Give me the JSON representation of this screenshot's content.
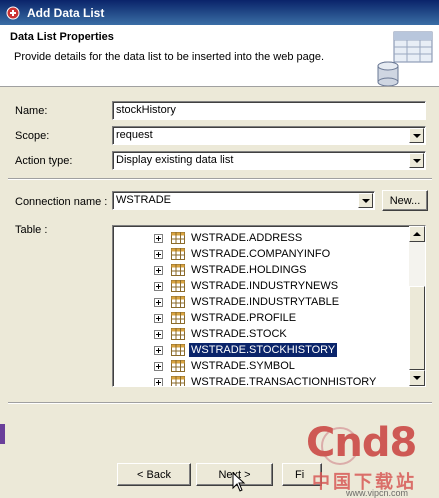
{
  "window": {
    "title": "Add Data List"
  },
  "header": {
    "title": "Data List Properties",
    "description": "Provide details for the data list to be inserted into the web page."
  },
  "form": {
    "name_label": "Name:",
    "name_value": "stockHistory",
    "scope_label": "Scope:",
    "scope_value": "request",
    "action_label": "Action type:",
    "action_value": "Display existing data list",
    "connection_label": "Connection name :",
    "connection_value": "WSTRADE",
    "new_button": "New...",
    "table_label": "Table :"
  },
  "tables": [
    {
      "label": "WSTRADE.ADDRESS",
      "selected": false
    },
    {
      "label": "WSTRADE.COMPANYINFO",
      "selected": false
    },
    {
      "label": "WSTRADE.HOLDINGS",
      "selected": false
    },
    {
      "label": "WSTRADE.INDUSTRYNEWS",
      "selected": false
    },
    {
      "label": "WSTRADE.INDUSTRYTABLE",
      "selected": false
    },
    {
      "label": "WSTRADE.PROFILE",
      "selected": false
    },
    {
      "label": "WSTRADE.STOCK",
      "selected": false
    },
    {
      "label": "WSTRADE.STOCKHISTORY",
      "selected": true
    },
    {
      "label": "WSTRADE.SYMBOL",
      "selected": false
    },
    {
      "label": "WSTRADE.TRANSACTIONHISTORY",
      "selected": false
    }
  ],
  "buttons": {
    "back": "< Back",
    "next": "Next >",
    "finish": "Fi"
  },
  "watermark": {
    "brand": "Cnd8",
    "cn_text": "中国下载站",
    "url": "www.vipcn.com"
  },
  "colors": {
    "selection": "#0a246a",
    "titlebar": "#0a246a",
    "dialog_bg": "#ece9d8"
  }
}
